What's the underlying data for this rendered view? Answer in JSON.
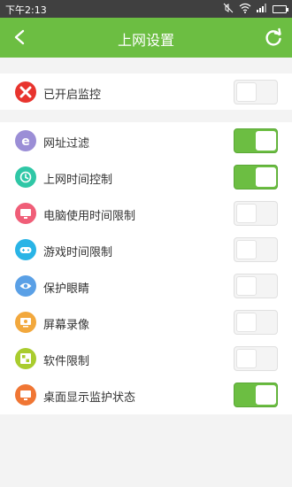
{
  "status_bar": {
    "time": "下午2:13",
    "battery_level": 0.8
  },
  "header": {
    "title": "上网设置",
    "back_icon": "back-arrow-icon",
    "refresh_icon": "refresh-icon"
  },
  "colors": {
    "accent": "#6cbe42",
    "status_bar": "#404040",
    "background": "#f3f3f3"
  },
  "monitor": {
    "label": "已开启监控",
    "icon": "close-icon",
    "icon_color": "#e8342e",
    "on": false
  },
  "settings": [
    {
      "label": "网址过滤",
      "icon": "ie-icon",
      "icon_color": "#9b8ed6",
      "on": true
    },
    {
      "label": "上网时间控制",
      "icon": "clock-icon",
      "icon_color": "#2fc7a6",
      "on": true
    },
    {
      "label": "电脑使用时间限制",
      "icon": "computer-icon",
      "icon_color": "#f05e78",
      "on": false
    },
    {
      "label": "游戏时间限制",
      "icon": "gamepad-icon",
      "icon_color": "#29b4e6",
      "on": false
    },
    {
      "label": "保护眼睛",
      "icon": "eye-icon",
      "icon_color": "#5aa0e6",
      "on": false
    },
    {
      "label": "屏幕录像",
      "icon": "screen-record-icon",
      "icon_color": "#f2a83d",
      "on": false
    },
    {
      "label": "软件限制",
      "icon": "software-icon",
      "icon_color": "#a9cc2e",
      "on": false
    },
    {
      "label": "桌面显示监护状态",
      "icon": "desktop-icon",
      "icon_color": "#f07634",
      "on": true
    }
  ]
}
